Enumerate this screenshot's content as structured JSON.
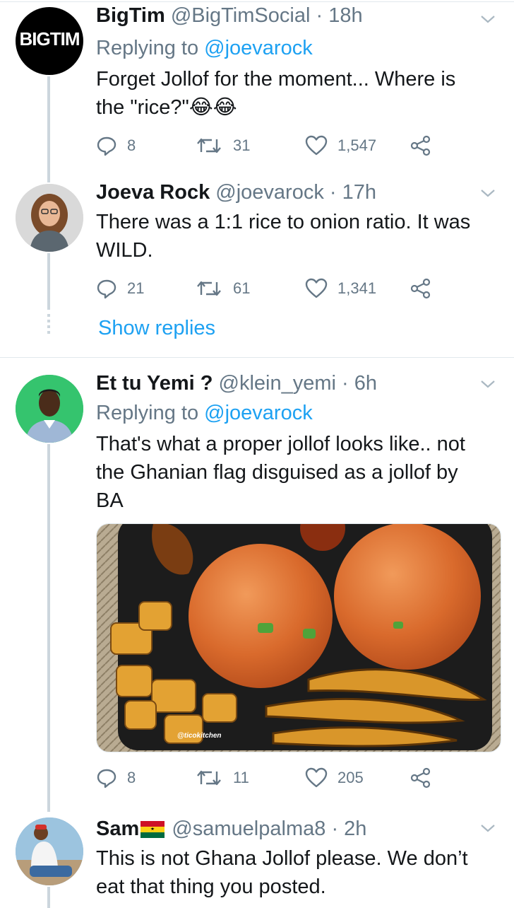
{
  "tweets": [
    {
      "avatar_text": "BIGTIM",
      "name": "BigTim",
      "handle": "@BigTimSocial",
      "time": "18h",
      "reply_prefix": "Replying to",
      "reply_to": "@joevarock",
      "text_line1": "Forget Jollof for the moment... Where is",
      "text_line2": "the \"rice?\"😂😂",
      "replies": "8",
      "retweets": "31",
      "likes": "1,547"
    },
    {
      "name": "Joeva Rock",
      "handle": "@joevarock",
      "time": "17h",
      "text_line1": "There was a 1:1 rice to onion ratio. It was",
      "text_line2": "WILD.",
      "replies": "21",
      "retweets": "61",
      "likes": "1,341",
      "show_replies": "Show replies"
    },
    {
      "name": "Et tu Yemi ?",
      "handle": "@klein_yemi",
      "time": "6h",
      "reply_prefix": "Replying to",
      "reply_to": "@joevarock",
      "text_line1": "That's what a proper jollof looks like.. not",
      "text_line2": "the Ghanian flag disguised as a jollof by",
      "text_line3": "BA",
      "media_watermark": "@ticokitchen",
      "replies": "8",
      "retweets": "11",
      "likes": "205"
    },
    {
      "name": "Sam",
      "handle": "@samuelpalma8",
      "time": "2h",
      "text_line1": "This is not Ghana Jollof please. We don’t",
      "text_line2": "eat that thing you posted."
    }
  ],
  "icons": {
    "reply": "reply-icon",
    "retweet": "retweet-icon",
    "like": "heart-icon",
    "share": "share-icon",
    "menu": "chevron-down-icon"
  },
  "colors": {
    "link": "#1da1f2",
    "secondary": "#657786",
    "thread_line": "#ccd6dd"
  }
}
